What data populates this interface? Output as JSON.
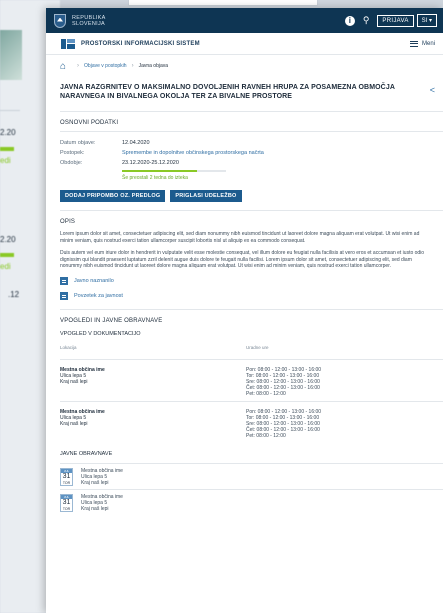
{
  "background": {
    "date_snippets": [
      "2.20",
      "2.20"
    ],
    "link_snippets": [
      "edi",
      "edi"
    ],
    "num_snippet": ".12"
  },
  "topbar": {
    "country_line1": "REPUBLIKA",
    "country_line2": "SLOVENIJA",
    "login": "PRIJAVA",
    "lang": "SI ▾"
  },
  "system": {
    "title": "PROSTORSKI INFORMACIJSKI SISTEM",
    "menu": "Meni"
  },
  "breadcrumb": {
    "parent": "Objave v postopkih",
    "current": "Javna objava"
  },
  "page": {
    "title": "JAVNA RAZGRNITEV O MAKSIMALNO DOVOLJENIH RAVNEH HRUPA ZA POSAMEZNA OBMOČJA NARAVNEGA IN BIVALNEGA OKOLJA TER ZA BIVALNE PROSTORE"
  },
  "basic": {
    "heading": "OSNOVNI PODATKI",
    "rows": [
      {
        "label": "Datum objave:",
        "value": "12.04.2020"
      },
      {
        "label": "Postopek:",
        "value": "Spremembe in dopolnitve občinskega prostorskega načrta"
      },
      {
        "label": "Obdobje:",
        "value": "23.12.2020-25.12.2020"
      }
    ],
    "progress": 0.72,
    "progress_note": "Še preostali 2 tedna do izteka",
    "buttons": [
      "DODAJ PRIPOMBO OZ. PREDLOG",
      "PRIGLASI UDELEŽBO"
    ]
  },
  "description": {
    "heading": "OPIS",
    "paragraphs": [
      "Lorem ipsum dolor sit amet, consectetuer adipiscing elit, sed diam nonummy nibh euismod tincidunt ut laoreet dolore magna aliquam erat volutpat. Ut wisi enim ad minim veniam, quis nostrud exerci tation ullamcorper suscipit lobortis nisl ut aliquip ex ea commodo consequat.",
      "Duis autem vel eum iriure dolor in hendrerit in vulputate velit esse molestie consequat, vel illum dolore eu feugiat nulla facilisis at vero eros et accumsan et iusto odio dignissim qui blandit praesent luptatum zzril delenit augue duis dolore te feugait nulla facilisi. Lorem ipsum dolor sit amet, consectetuer adipiscing elit, sed diam nonummy nibh euismod tincidunt ut laoreet dolore magna aliquam erat volutpat. Ut wisi enim ad minim veniam, quis nostrud exerci tation ullamcorper."
    ],
    "links": [
      "Javno naznanilo",
      "Povzetek za javnost"
    ]
  },
  "insights": {
    "heading": "VPOGLEDI IN JAVNE OBRAVNAVE",
    "docs_heading": "VPOGLED V DOKUMENTACIJO",
    "col_location": "Lokacija",
    "col_hours": "Uradne ure",
    "locations": [
      {
        "name": "Mestna občina ime",
        "street": "Ulica lepa 5",
        "place": "Kraj naš lepi",
        "hours": [
          "Pon: 08:00 - 12:00 - 13:00 - 16:00",
          "Tor: 08:00 - 12:00 - 13:00 - 16:00",
          "Sre: 08:00 - 12:00 - 13:00 - 16:00",
          "Čet: 08:00 - 12:00 - 13:00 - 16:00",
          "Pet: 08:00 - 12:00"
        ]
      },
      {
        "name": "Mestna občina ime",
        "street": "Ulica lepa 5",
        "place": "Kraj naš lepi",
        "hours": [
          "Pon: 08:00 - 12:00 - 13:00 - 16:00",
          "Tor: 08:00 - 12:00 - 13:00 - 16:00",
          "Sre: 08:00 - 12:00 - 13:00 - 16:00",
          "Čet: 08:00 - 12:00 - 13:00 - 16:00",
          "Pet: 08:00 - 12:00"
        ]
      }
    ],
    "hearings_heading": "JAVNE OBRAVNAVE",
    "hearings": [
      {
        "month": "JUL",
        "day": "31",
        "dow": "TOR",
        "name": "Mestna občina ime",
        "street": "Ulica lepa 5",
        "place": "Kraj naš lepi"
      },
      {
        "month": "JUL",
        "day": "31",
        "dow": "TOR",
        "name": "Mestna občina ime",
        "street": "Ulica lepa 5",
        "place": "Kraj naš lepi"
      }
    ]
  }
}
